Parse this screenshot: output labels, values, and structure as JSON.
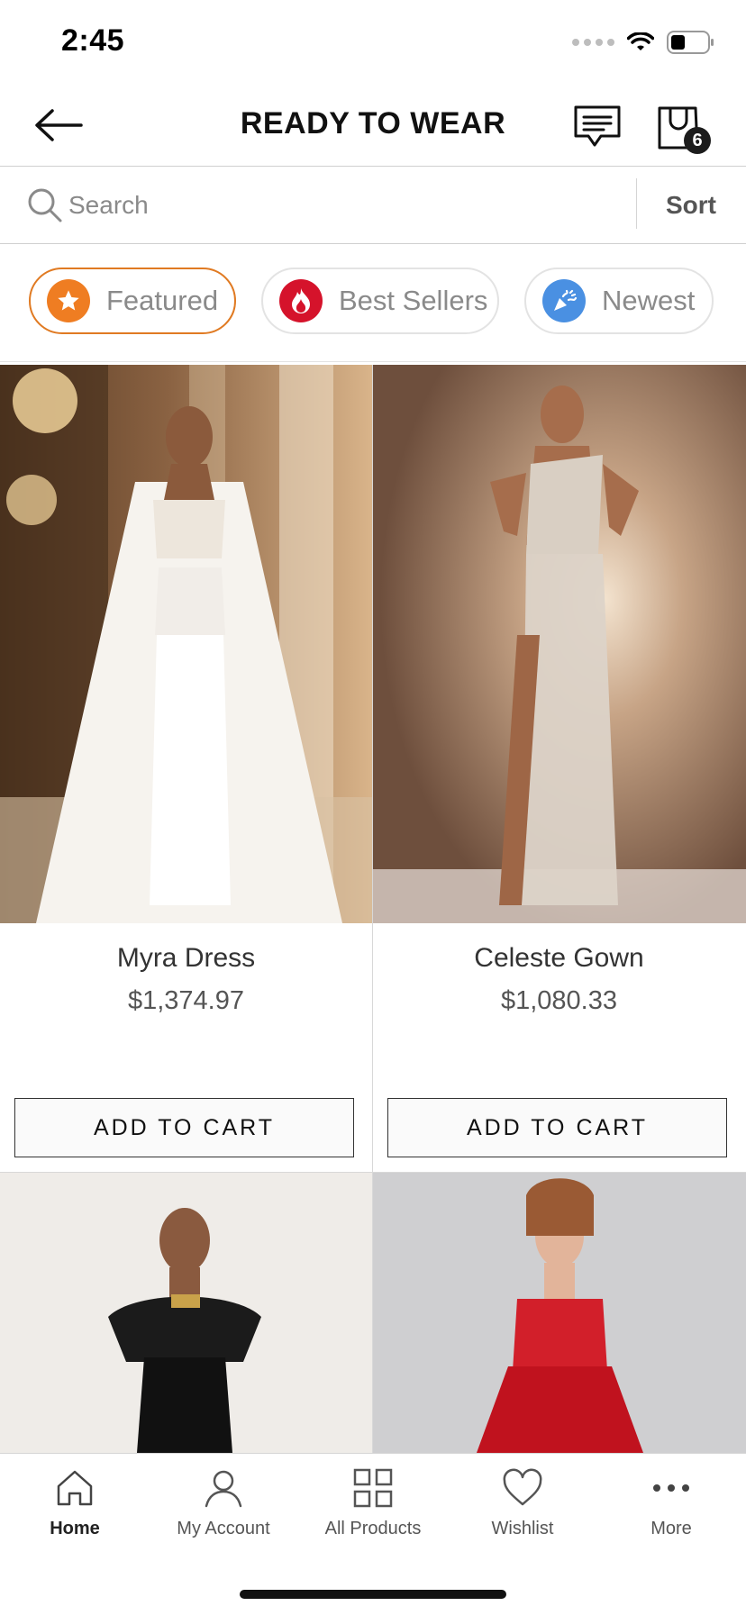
{
  "status_bar": {
    "time": "2:45"
  },
  "header": {
    "title": "READY TO WEAR",
    "cart_count": "6"
  },
  "search": {
    "placeholder": "Search",
    "sort_label": "Sort"
  },
  "filters": [
    {
      "label": "Featured",
      "icon": "star-icon",
      "color": "#ef7d22",
      "active": true
    },
    {
      "label": "Best Sellers",
      "icon": "flame-icon",
      "color": "#d5132b",
      "active": false
    },
    {
      "label": "Newest",
      "icon": "party-popper-icon",
      "color": "#4a90e2",
      "active": false
    }
  ],
  "products": [
    {
      "name": "Myra Dress",
      "price": "$1,374.97",
      "button": "ADD TO CART"
    },
    {
      "name": "Celeste Gown",
      "price": "$1,080.33",
      "button": "ADD TO CART"
    },
    {
      "name": "",
      "price": "",
      "button": ""
    },
    {
      "name": "",
      "price": "",
      "button": ""
    }
  ],
  "bottom_nav": [
    {
      "label": "Home",
      "icon": "home-icon",
      "active": true
    },
    {
      "label": "My Account",
      "icon": "user-icon",
      "active": false
    },
    {
      "label": "All Products",
      "icon": "grid-icon",
      "active": false
    },
    {
      "label": "Wishlist",
      "icon": "heart-icon",
      "active": false
    },
    {
      "label": "More",
      "icon": "more-dots-icon",
      "active": false
    }
  ],
  "colors": {
    "accent": "#e07a22",
    "border": "#d5d5d5"
  }
}
